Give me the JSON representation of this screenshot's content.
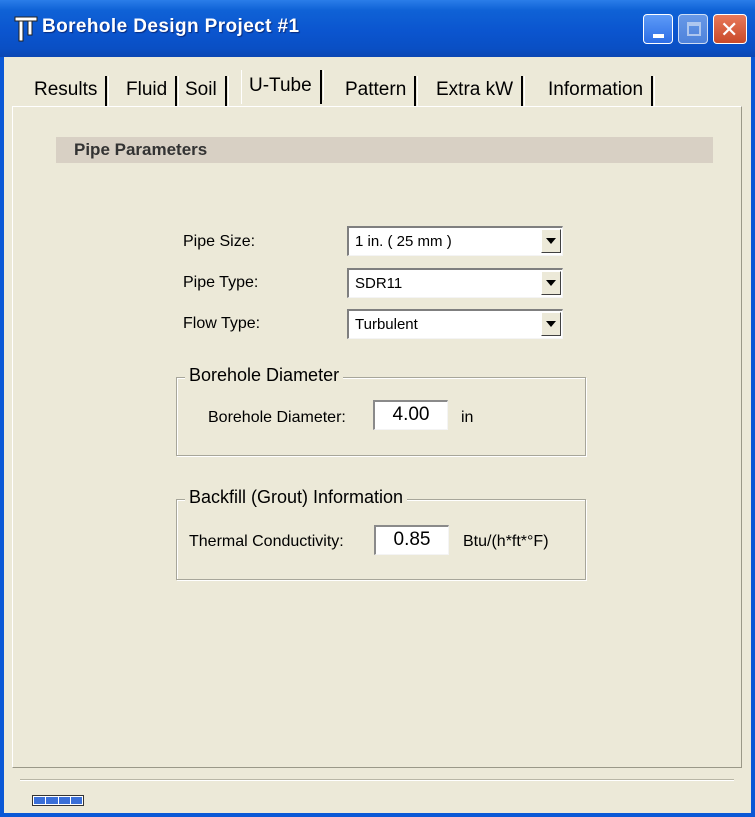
{
  "window": {
    "title": "Borehole Design Project #1",
    "colors": {
      "titlebar": "#0b55cf",
      "body": "#ece9d8",
      "section_bar": "#d8d0c4"
    },
    "controls": [
      "minimize-icon",
      "maximize-icon",
      "close-icon"
    ],
    "close_glyph": "✕"
  },
  "tabs": [
    {
      "label": "Results"
    },
    {
      "label": "Fluid"
    },
    {
      "label": "Soil"
    },
    {
      "label": "U-Tube",
      "active": true
    },
    {
      "label": "Pattern"
    },
    {
      "label": "Extra kW"
    },
    {
      "label": "Information"
    }
  ],
  "section": {
    "title": "Pipe Parameters"
  },
  "pipe": {
    "size": {
      "label": "Pipe Size:",
      "value": "1 in. ( 25 mm )"
    },
    "type": {
      "label": "Pipe Type:",
      "value": "SDR11"
    },
    "flow": {
      "label": "Flow Type:",
      "value": "Turbulent"
    }
  },
  "borehole": {
    "group_title": "Borehole Diameter",
    "label": "Borehole Diameter:",
    "value": "4.00",
    "unit": "in"
  },
  "backfill": {
    "group_title": "Backfill (Grout) Information",
    "label": "Thermal Conductivity:",
    "value": "0.85",
    "unit": "Btu/(h*ft*°F)"
  }
}
